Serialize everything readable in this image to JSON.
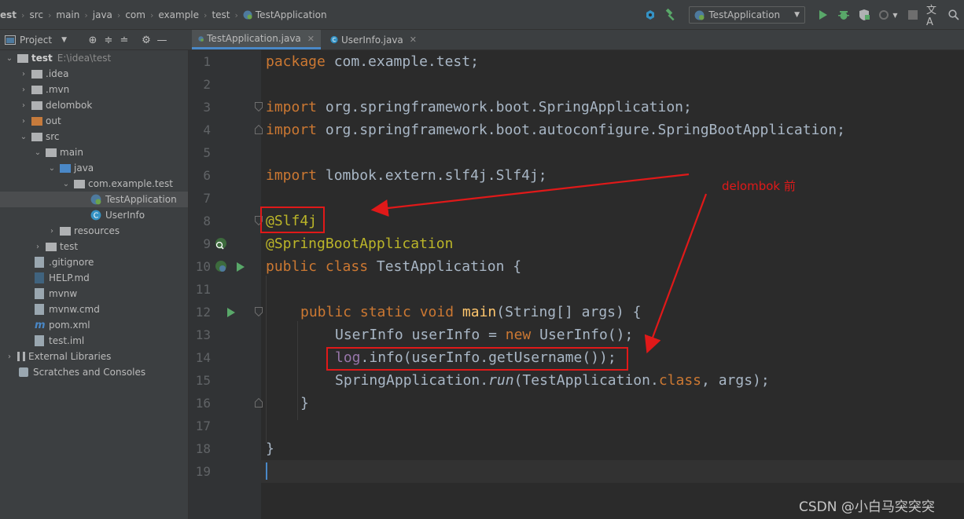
{
  "breadcrumb": {
    "items": [
      "est",
      "src",
      "main",
      "java",
      "com",
      "example",
      "test",
      "TestApplication"
    ]
  },
  "toolbar": {
    "run_config": "TestApplication"
  },
  "project_panel": {
    "title": "Project"
  },
  "tabs": [
    {
      "label": "TestApplication.java",
      "active": true
    },
    {
      "label": "UserInfo.java",
      "active": false
    }
  ],
  "tree": {
    "root_name": "test",
    "root_path": "E:\\idea\\test",
    "items": [
      {
        "label": ".idea"
      },
      {
        "label": ".mvn"
      },
      {
        "label": "delombok"
      },
      {
        "label": "out"
      },
      {
        "label": "src"
      },
      {
        "label": "main"
      },
      {
        "label": "java"
      },
      {
        "label": "com.example.test"
      },
      {
        "label": "TestApplication"
      },
      {
        "label": "UserInfo"
      },
      {
        "label": "resources"
      },
      {
        "label": "test"
      },
      {
        "label": ".gitignore"
      },
      {
        "label": "HELP.md"
      },
      {
        "label": "mvnw"
      },
      {
        "label": "mvnw.cmd"
      },
      {
        "label": "pom.xml"
      },
      {
        "label": "test.iml"
      },
      {
        "label": "External Libraries"
      },
      {
        "label": "Scratches and Consoles"
      }
    ]
  },
  "editor": {
    "line_numbers": [
      "1",
      "2",
      "3",
      "4",
      "5",
      "6",
      "7",
      "8",
      "9",
      "10",
      "11",
      "12",
      "13",
      "14",
      "15",
      "16",
      "17",
      "18",
      "19"
    ],
    "lines": {
      "l1": {
        "kw": "package",
        "rest": " com.example.test;"
      },
      "l3": {
        "kw": "import",
        "rest": " org.springframework.boot.SpringApplication;"
      },
      "l4": {
        "kw": "import",
        "rest": " org.springframework.boot.autoconfigure.SpringBootApplication;"
      },
      "l6": {
        "kw": "import",
        "rest": " lombok.extern.slf4j.Slf4j;"
      },
      "l8": {
        "ann": "@Slf4j"
      },
      "l9": {
        "ann": "@SpringBootApplication"
      },
      "l10": {
        "kw": "public class",
        "rest": " TestApplication {"
      },
      "l12": {
        "kw": "public static void",
        "fn": "main",
        "rest": "(String[] args) {"
      },
      "l13": {
        "a": "UserInfo userInfo = ",
        "kw": "new",
        "b": " UserInfo();"
      },
      "l14": {
        "mem": "log",
        "a": ".",
        "fn2": "info",
        "b": "(userInfo.",
        "fn3": "getUsername",
        "c": "());"
      },
      "l15": {
        "a": "SpringApplication.",
        "fn2": "run",
        "b": "(TestApplication.",
        "kw": "class",
        "c": ", args);"
      },
      "l16": {
        "a": "}"
      },
      "l18": {
        "a": "}"
      }
    }
  },
  "annotation": {
    "label": "delombok 前"
  },
  "watermark": "CSDN @小白马突突突"
}
